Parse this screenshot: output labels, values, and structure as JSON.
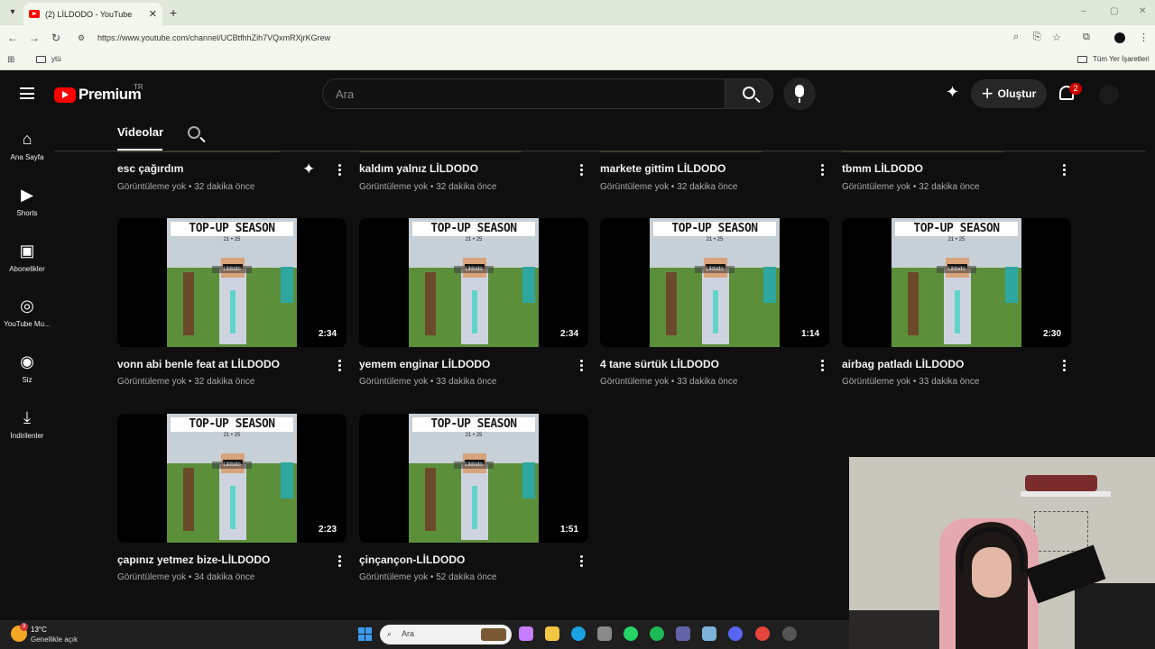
{
  "browser": {
    "tab_title": "(2) LİLDODO - YouTube",
    "tab_close": "✕",
    "new_tab": "+",
    "url": "https://www.youtube.com/channel/UCBtfhhZih7VQxmRXjrKGrew",
    "bookmark_folder": "ytü",
    "all_bookmarks": "Tüm Yer İşaretleri",
    "window_controls": [
      "–",
      "▢",
      "✕"
    ]
  },
  "masthead": {
    "logo_text": "Premium",
    "country_code": "TR",
    "search_placeholder": "Ara",
    "create_label": "Oluştur",
    "notification_count": "2"
  },
  "sidebar": {
    "items": [
      {
        "label": "Ana Sayfa",
        "icon": "home-icon"
      },
      {
        "label": "Shorts",
        "icon": "shorts-icon"
      },
      {
        "label": "Abonelikler",
        "icon": "subscriptions-icon"
      },
      {
        "label": "YouTube Mu...",
        "icon": "youtube-music-icon"
      },
      {
        "label": "Siz",
        "icon": "you-icon"
      },
      {
        "label": "İndirilenler",
        "icon": "downloads-icon"
      }
    ]
  },
  "channel_tabs": {
    "active": "Videolar"
  },
  "thumbnail_art": {
    "banner": "TOP-UP SEASON",
    "banner_sub": "21 • 25",
    "tag": "Lildodo"
  },
  "videos_top_row": [
    {
      "title": "esc çağırdım",
      "meta": "Görüntüleme yok • 32 dakika önce"
    },
    {
      "title": "kaldım yalnız LİLDODO",
      "meta": "Görüntüleme yok • 32 dakika önce"
    },
    {
      "title": "markete gittim LİLDODO",
      "meta": "Görüntüleme yok • 32 dakika önce"
    },
    {
      "title": "tbmm LİLDODO",
      "meta": "Görüntüleme yok • 32 dakika önce"
    }
  ],
  "videos": [
    {
      "title": "vonn abi benle feat at LİLDODO",
      "meta": "Görüntüleme yok • 32 dakika önce",
      "duration": "2:34"
    },
    {
      "title": "yemem enginar LİLDODO",
      "meta": "Görüntüleme yok • 33 dakika önce",
      "duration": "2:34"
    },
    {
      "title": "4 tane sürtük LİLDODO",
      "meta": "Görüntüleme yok • 33 dakika önce",
      "duration": "1:14"
    },
    {
      "title": "airbag patladı LİLDODO",
      "meta": "Görüntüleme yok • 33 dakika önce",
      "duration": "2:30"
    },
    {
      "title": "çapınız yetmez bize-LİLDODO",
      "meta": "Görüntüleme yok • 34 dakika önce",
      "duration": "2:23"
    },
    {
      "title": "çinçançon-LİLDODO",
      "meta": "Görüntüleme yok • 52 dakika önce",
      "duration": "1:51"
    }
  ],
  "taskbar": {
    "temperature": "13°C",
    "weather_desc": "Genellikle açık",
    "weather_badge": "3",
    "search_placeholder": "Ara"
  },
  "colors": {
    "youtube_red": "#ff0000",
    "background": "#0f0f0f",
    "meta_text": "#aaaaaa"
  }
}
